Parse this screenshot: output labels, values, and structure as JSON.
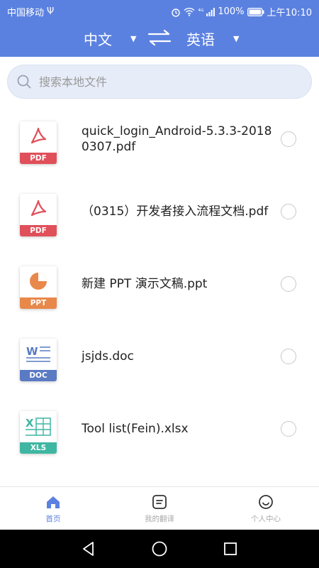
{
  "status": {
    "carrier": "中国移动",
    "usb": "Ψ",
    "battery_text": "100%",
    "time": "上午10:10",
    "signal": "⁴ᴳ"
  },
  "header": {
    "source_lang": "中文",
    "target_lang": "英语",
    "caret": "▼"
  },
  "search": {
    "placeholder": "搜索本地文件"
  },
  "files": [
    {
      "name": "quick_login_Android-5.3.3-20180307.pdf",
      "type": "PDF",
      "color": "#e0505a"
    },
    {
      "name": "（0315）开发者接入流程文档.pdf",
      "type": "PDF",
      "color": "#e0505a"
    },
    {
      "name": "新建 PPT 演示文稿.ppt",
      "type": "PPT",
      "color": "#e8884a"
    },
    {
      "name": "jsjds.doc",
      "type": "DOC",
      "color": "#5a7ac4"
    },
    {
      "name": "Tool list(Fein).xlsx",
      "type": "XLS",
      "color": "#3fb6a2"
    }
  ],
  "tabs": [
    {
      "label": "首页",
      "active": true
    },
    {
      "label": "我的翻译",
      "active": false
    },
    {
      "label": "个人中心",
      "active": false
    }
  ],
  "colors": {
    "accent": "#5b81e0"
  }
}
